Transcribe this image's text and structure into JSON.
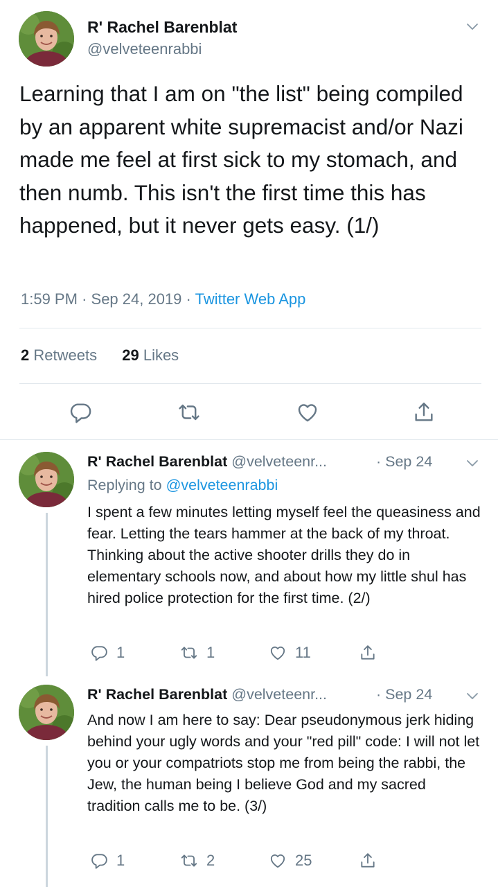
{
  "main_tweet": {
    "author_name": "R' Rachel Barenblat",
    "handle": "@velveteenrabbi",
    "text": "Learning that I am on \"the list\" being compiled by an apparent white supremacist and/or Nazi made me feel at first sick to my stomach, and then numb. This isn't the first time this has happened, but it never gets easy.  (1/)",
    "time": "1:59 PM",
    "date": "Sep 24, 2019",
    "source": "Twitter Web App",
    "separator": "·",
    "retweets_count": "2",
    "retweets_label": "Retweets",
    "likes_count": "29",
    "likes_label": "Likes",
    "icons": [
      "reply-icon",
      "retweet-icon",
      "like-icon",
      "share-icon"
    ]
  },
  "replies": [
    {
      "author_name": "R' Rachel Barenblat",
      "handle": "@velveteenr...",
      "date": "· Sep 24",
      "replying_prefix": "Replying to",
      "replying_to": "@velveteenrabbi",
      "text": "I spent a few minutes letting myself feel the queasiness and fear. Letting the tears hammer at the back of my throat. Thinking about the active shooter drills they do in elementary schools now, and about how my little shul has hired police protection for the first time. (2/)",
      "reply_count": "1",
      "retweet_count": "1",
      "like_count": "11"
    },
    {
      "author_name": "R' Rachel Barenblat",
      "handle": "@velveteenr...",
      "date": "· Sep 24",
      "text": "And now I am here to say: Dear pseudonymous jerk hiding behind your ugly words and your \"red pill\" code: I will not let you or your compatriots stop me from being the rabbi, the Jew, the human being I believe God and my sacred tradition calls me to be. (3/)",
      "reply_count": "1",
      "retweet_count": "2",
      "like_count": "25"
    }
  ],
  "colors": {
    "text": "#14171a",
    "secondary": "#657786",
    "link": "#1b95e0",
    "divider": "#e1e8ed",
    "thread_line": "#ccd6dd"
  }
}
